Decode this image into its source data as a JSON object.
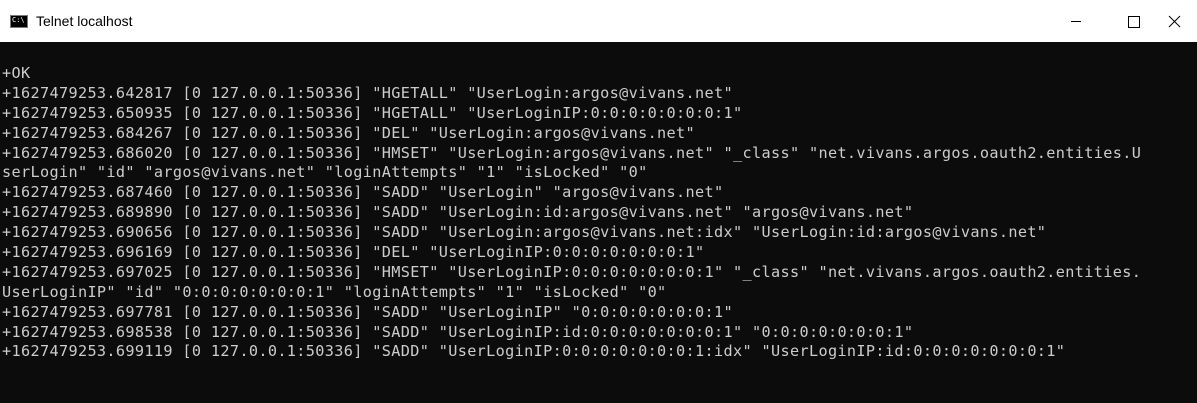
{
  "window": {
    "title": "Telnet localhost",
    "icon": "console-icon",
    "icon_glyph": "C:\\",
    "controls": {
      "minimize": "minimize-icon",
      "maximize": "maximize-icon",
      "close": "close-icon"
    }
  },
  "console": {
    "lines": [
      "+OK",
      "+1627479253.642817 [0 127.0.0.1:50336] \"HGETALL\" \"UserLogin:argos@vivans.net\"",
      "+1627479253.650935 [0 127.0.0.1:50336] \"HGETALL\" \"UserLoginIP:0:0:0:0:0:0:0:1\"",
      "+1627479253.684267 [0 127.0.0.1:50336] \"DEL\" \"UserLogin:argos@vivans.net\"",
      "+1627479253.686020 [0 127.0.0.1:50336] \"HMSET\" \"UserLogin:argos@vivans.net\" \"_class\" \"net.vivans.argos.oauth2.entities.U",
      "serLogin\" \"id\" \"argos@vivans.net\" \"loginAttempts\" \"1\" \"isLocked\" \"0\"",
      "+1627479253.687460 [0 127.0.0.1:50336] \"SADD\" \"UserLogin\" \"argos@vivans.net\"",
      "+1627479253.689890 [0 127.0.0.1:50336] \"SADD\" \"UserLogin:id:argos@vivans.net\" \"argos@vivans.net\"",
      "+1627479253.690656 [0 127.0.0.1:50336] \"SADD\" \"UserLogin:argos@vivans.net:idx\" \"UserLogin:id:argos@vivans.net\"",
      "+1627479253.696169 [0 127.0.0.1:50336] \"DEL\" \"UserLoginIP:0:0:0:0:0:0:0:1\"",
      "+1627479253.697025 [0 127.0.0.1:50336] \"HMSET\" \"UserLoginIP:0:0:0:0:0:0:0:1\" \"_class\" \"net.vivans.argos.oauth2.entities.",
      "UserLoginIP\" \"id\" \"0:0:0:0:0:0:0:1\" \"loginAttempts\" \"1\" \"isLocked\" \"0\"",
      "+1627479253.697781 [0 127.0.0.1:50336] \"SADD\" \"UserLoginIP\" \"0:0:0:0:0:0:0:1\"",
      "+1627479253.698538 [0 127.0.0.1:50336] \"SADD\" \"UserLoginIP:id:0:0:0:0:0:0:0:1\" \"0:0:0:0:0:0:0:1\"",
      "+1627479253.699119 [0 127.0.0.1:50336] \"SADD\" \"UserLoginIP:0:0:0:0:0:0:0:1:idx\" \"UserLoginIP:id:0:0:0:0:0:0:0:1\""
    ]
  },
  "colors": {
    "titlebar_bg": "#ffffff",
    "console_bg": "#0c0c0c",
    "console_text": "#cccccc"
  }
}
